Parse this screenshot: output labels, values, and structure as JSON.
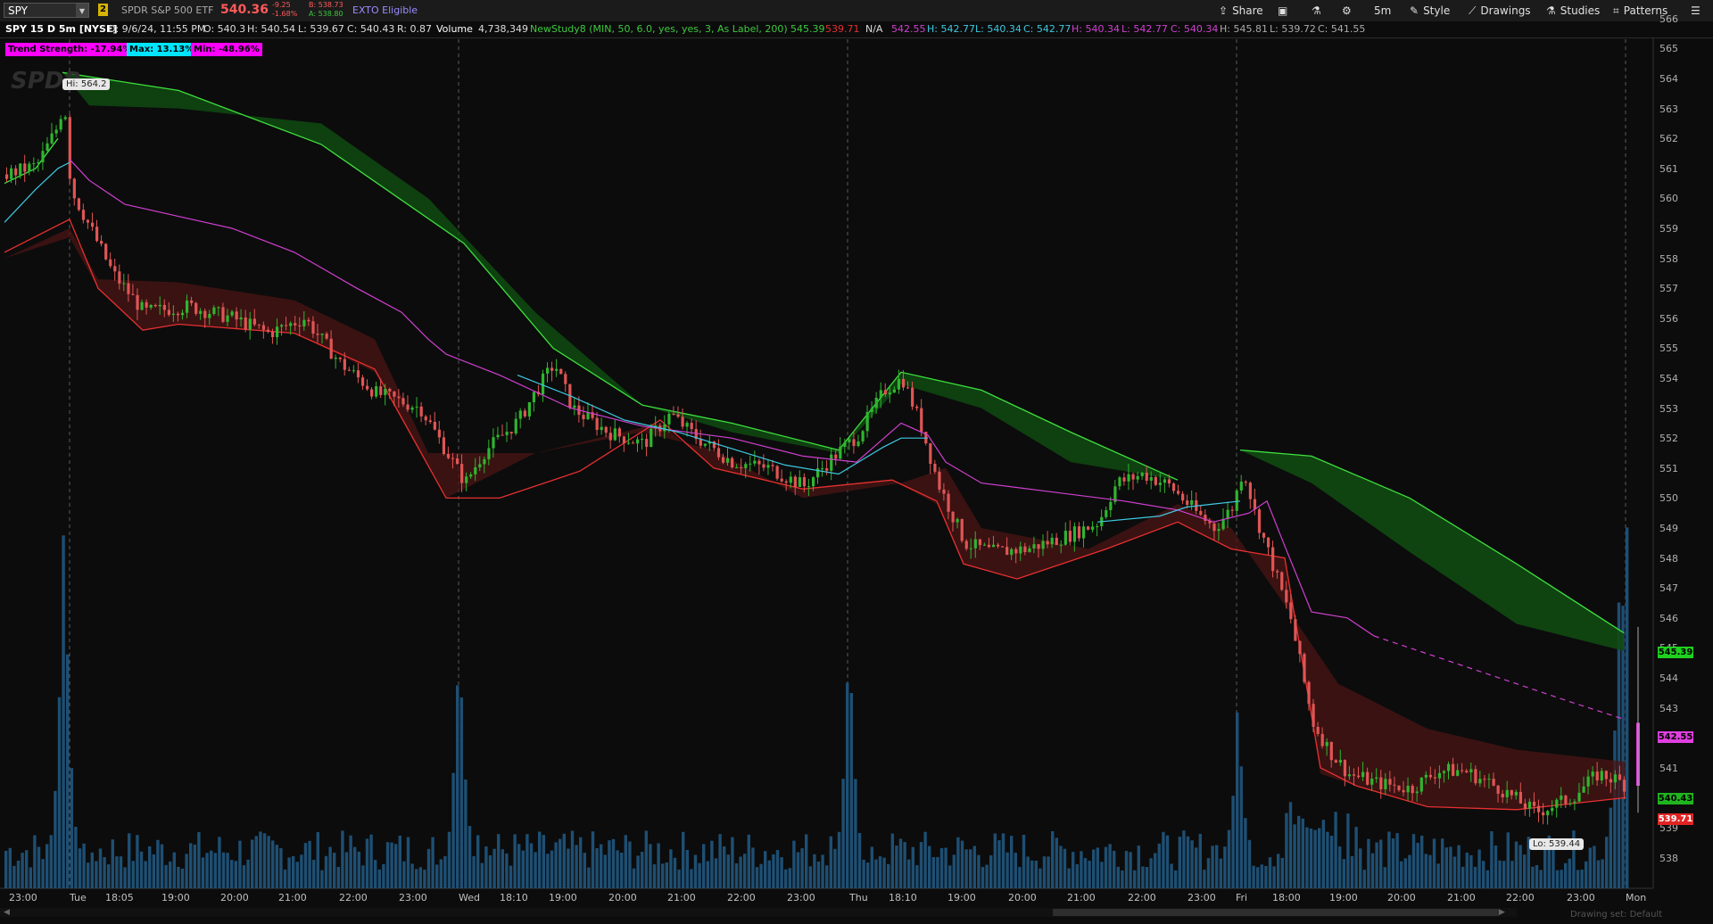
{
  "header": {
    "symbol": "SPY",
    "link_badge": "2",
    "description": "SPDR S&P 500 ETF",
    "last_price": "540.36",
    "change_net": "-9.25",
    "change_pct": "-1.68%",
    "bid": "B: 538.73",
    "ask": "A: 538.80",
    "exto": "EXTO Eligible",
    "buttons": {
      "share": "Share",
      "timeframe": "5m",
      "style": "Style",
      "drawings": "Drawings",
      "studies": "Studies",
      "patterns": "Patterns"
    }
  },
  "infobar": {
    "title": "SPY 15 D 5m [NYSE]",
    "date": "D: 9/6/24, 11:55 PM",
    "open": "O: 540.3",
    "high": "H: 540.54",
    "low": "L: 539.67",
    "close": "C: 540.43",
    "range": "R: 0.87",
    "volume_label": "Volume",
    "volume_value": "4,738,349",
    "study": "NewStudy8 (MIN, 50, 6.0, yes, yes, 3, As Label, 200)",
    "study_v1": "545.39",
    "study_v2": "539.71",
    "study_v3": "N/A",
    "study_v4": "542.55",
    "h1": "H: 542.77",
    "l1": "L: 540.34",
    "c1": "C: 542.77",
    "h2": "H: 540.34",
    "l2": "L: 542.77",
    "c2": "C: 540.34",
    "h3": "H: 545.81",
    "l3": "L: 539.72",
    "c3": "C: 541.55"
  },
  "labels": {
    "trend": "Trend Strength: -17.94%",
    "max": "Max: 13.13%",
    "min": "Min: -48.96%",
    "hi": "Hi: 564.2",
    "lo": "Lo: 539.44",
    "watermark": "SPDR",
    "drawing_set": "Drawing set: Default"
  },
  "price_axis": [
    "566",
    "565",
    "564",
    "563",
    "562",
    "561",
    "560",
    "559",
    "558",
    "557",
    "556",
    "555",
    "554",
    "553",
    "552",
    "551",
    "550",
    "549",
    "548",
    "547",
    "546",
    "545",
    "544",
    "543",
    "542",
    "541",
    "540",
    "539",
    "538"
  ],
  "price_tags": {
    "green_top": "545.39",
    "magenta": "542.55",
    "green_last": "540.43",
    "red_last": "539.71"
  },
  "time_axis": [
    "23:00",
    "Tue",
    "18:05",
    "19:00",
    "20:00",
    "21:00",
    "22:00",
    "23:00",
    "Wed",
    "18:10",
    "19:00",
    "20:00",
    "21:00",
    "22:00",
    "23:00",
    "Thu",
    "18:10",
    "19:00",
    "20:00",
    "21:00",
    "22:00",
    "23:00",
    "Fri",
    "18:00",
    "19:00",
    "20:00",
    "21:00",
    "22:00",
    "23:00",
    "Mon"
  ],
  "colors": {
    "up": "#2fb52f",
    "down": "#e05555",
    "green_line": "#3ee03e",
    "red_line": "#e83030",
    "magenta": "#d040d0",
    "cyan": "#3ec8e0",
    "volume": "#1e4f73"
  }
}
